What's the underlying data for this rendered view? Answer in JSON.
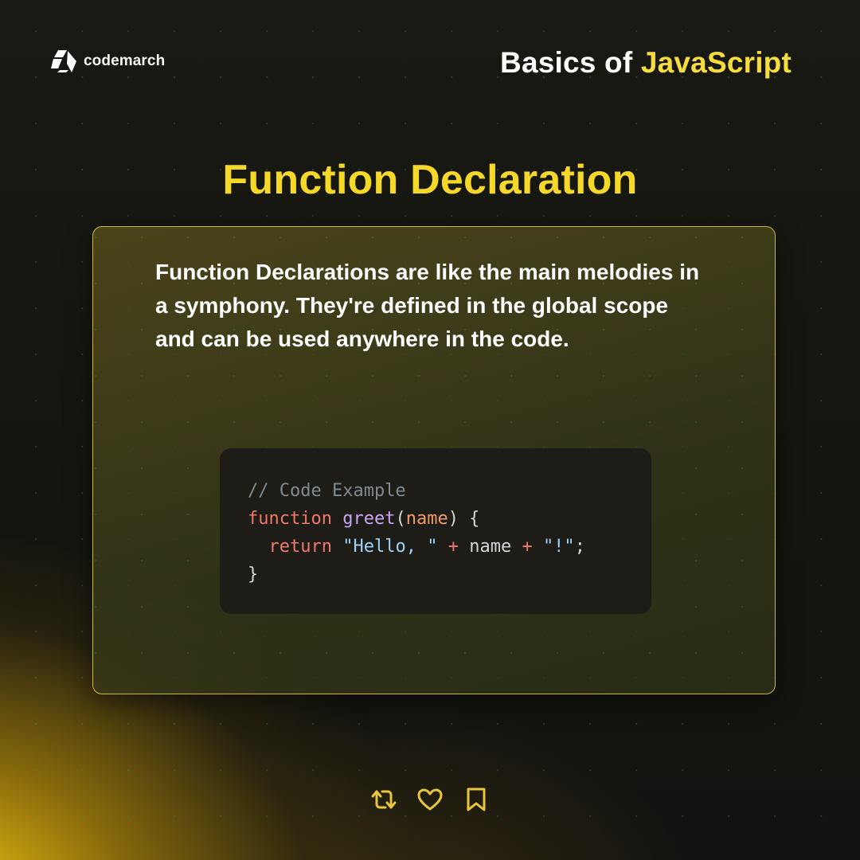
{
  "brand": {
    "name": "codemarch",
    "logo_icon": "codemarch-logo-icon"
  },
  "header": {
    "title_prefix": "Basics of ",
    "title_accent": "JavaScript"
  },
  "slide": {
    "title": "Function Declaration",
    "description": "Function Declarations are like the main melodies in a symphony. They're defined in the global scope and can be used anywhere in the code."
  },
  "code": {
    "line1": {
      "comment": "// Code Example"
    },
    "line2": {
      "keyword": "function",
      "space": " ",
      "name": "greet",
      "open_paren": "(",
      "param": "name",
      "close": ") {"
    },
    "line3": {
      "indent": "  ",
      "keyword": "return",
      "space1": " ",
      "string1": "\"Hello, \"",
      "space2": " ",
      "op1": "+",
      "space3": " ",
      "ident": "name",
      "space4": " ",
      "op2": "+",
      "space5": " ",
      "string2": "\"!\"",
      "end": ";"
    },
    "line4": {
      "close_brace": "}"
    }
  },
  "actions": [
    {
      "icon": "repost-icon"
    },
    {
      "icon": "heart-icon"
    },
    {
      "icon": "bookmark-icon"
    }
  ],
  "colors": {
    "accent_yellow": "#f6d928",
    "background": "#161611",
    "card_border": "#e2d042",
    "code_background": "#1d1c16"
  }
}
